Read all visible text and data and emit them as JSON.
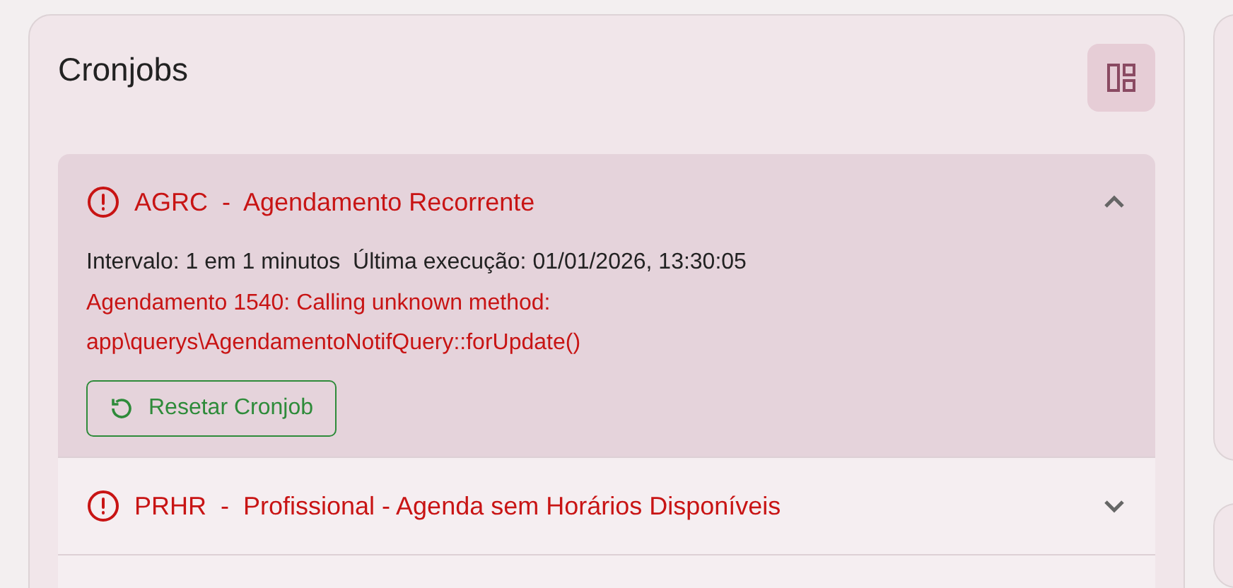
{
  "panel": {
    "title": "Cronjobs"
  },
  "cronjobs": [
    {
      "title": "AGRC  -  Agendamento Recorrente",
      "kind": "error",
      "expanded": true,
      "info": "Intervalo: 1 em 1 minutos  Última execução: 01/01/2026, 13:30:05",
      "error": "Agendamento 1540: Calling unknown method: app\\querys\\AgendamentoNotifQuery::forUpdate()",
      "action": "Resetar Cronjob"
    },
    {
      "title": "PRHR  -  Profissional - Agenda sem Horários Disponíveis",
      "kind": "error",
      "expanded": false
    }
  ]
}
